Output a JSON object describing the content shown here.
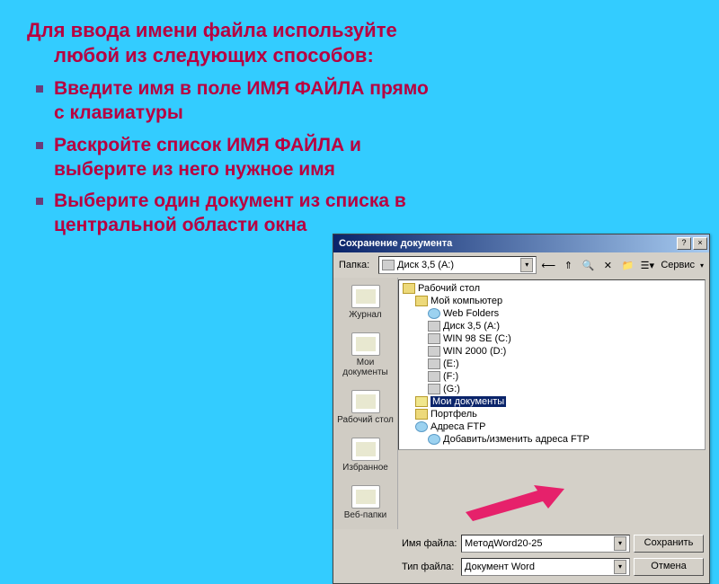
{
  "slide": {
    "heading": "Для ввода имени файла используйте любой из следующих способов:",
    "bullets": [
      "Введите имя в поле ИМЯ ФАЙЛА прямо с клавиатуры",
      "Раскройте список ИМЯ ФАЙЛА и выберите из него нужное имя",
      "Выберите один документ из списка в центральной области окна"
    ]
  },
  "dialog": {
    "title": "Сохранение документа",
    "folder_label": "Папка:",
    "current_folder": "Диск 3,5 (A:)",
    "service_label": "Сервис",
    "places": [
      "Журнал",
      "Мои документы",
      "Рабочий стол",
      "Избранное",
      "Веб-папки"
    ],
    "tree": {
      "root": "Рабочий стол",
      "mycomputer": "Мой компьютер",
      "items": [
        "Web Folders",
        "Диск 3,5 (A:)",
        "WIN 98 SE (C:)",
        "WIN 2000 (D:)",
        "(E:)",
        "(F:)",
        "(G:)"
      ],
      "selected": "Мои документы",
      "portfolio": "Портфель",
      "ftp": "Адреса FTP",
      "ftp_add": "Добавить/изменить адреса FTP"
    },
    "filename_label": "Имя файла:",
    "filename_value": "МетодWord20-25",
    "filetype_label": "Тип файла:",
    "filetype_value": "Документ Word",
    "save_label": "Сохранить",
    "cancel_label": "Отмена"
  }
}
